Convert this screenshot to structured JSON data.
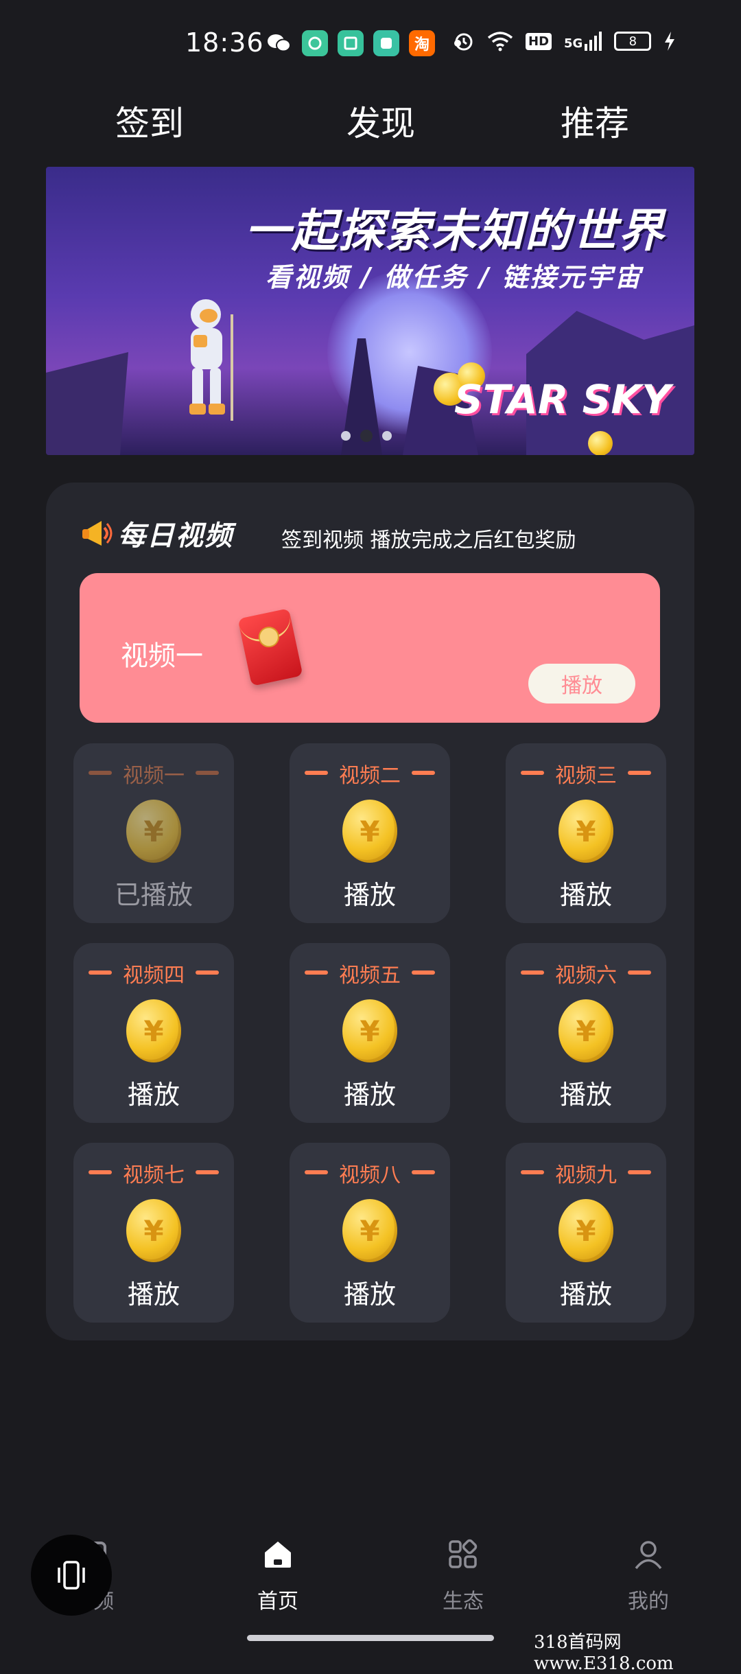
{
  "status_bar": {
    "time": "18:36",
    "network": "5G",
    "hd": "HD",
    "battery": "8"
  },
  "top_tabs": [
    {
      "label": "签到"
    },
    {
      "label": "发现"
    },
    {
      "label": "推荐"
    }
  ],
  "banner": {
    "title": "一起探索未知的世界",
    "subtitle": "看视频 / 做任务 / 链接元宇宙",
    "brand": "STAR SKY",
    "active_slide": 2,
    "slide_count": 3
  },
  "daily": {
    "logo_text": "每日视频",
    "description": "签到视频 播放完成之后红包奖励",
    "featured": {
      "label": "视频一",
      "button": "播放"
    },
    "tiles": [
      {
        "name": "视频一",
        "button": "已播放",
        "played": true
      },
      {
        "name": "视频二",
        "button": "播放",
        "played": false
      },
      {
        "name": "视频三",
        "button": "播放",
        "played": false
      },
      {
        "name": "视频四",
        "button": "播放",
        "played": false
      },
      {
        "name": "视频五",
        "button": "播放",
        "played": false
      },
      {
        "name": "视频六",
        "button": "播放",
        "played": false
      },
      {
        "name": "视频七",
        "button": "播放",
        "played": false
      },
      {
        "name": "视频八",
        "button": "播放",
        "played": false
      },
      {
        "name": "视频九",
        "button": "播放",
        "played": false
      }
    ],
    "coin_symbol": "¥"
  },
  "bottom_nav": [
    {
      "label": "视频",
      "icon": "video-icon"
    },
    {
      "label": "首页",
      "icon": "home-icon",
      "active": true
    },
    {
      "label": "生态",
      "icon": "ecosystem-icon"
    },
    {
      "label": "我的",
      "icon": "profile-icon"
    }
  ],
  "watermark": "318首码网  www.E318.com",
  "colors": {
    "background": "#1b1b1f",
    "card": "#26272e",
    "tile": "#33353f",
    "accent_orange": "#ff7d52",
    "featured_pink": "#ff8c94"
  }
}
